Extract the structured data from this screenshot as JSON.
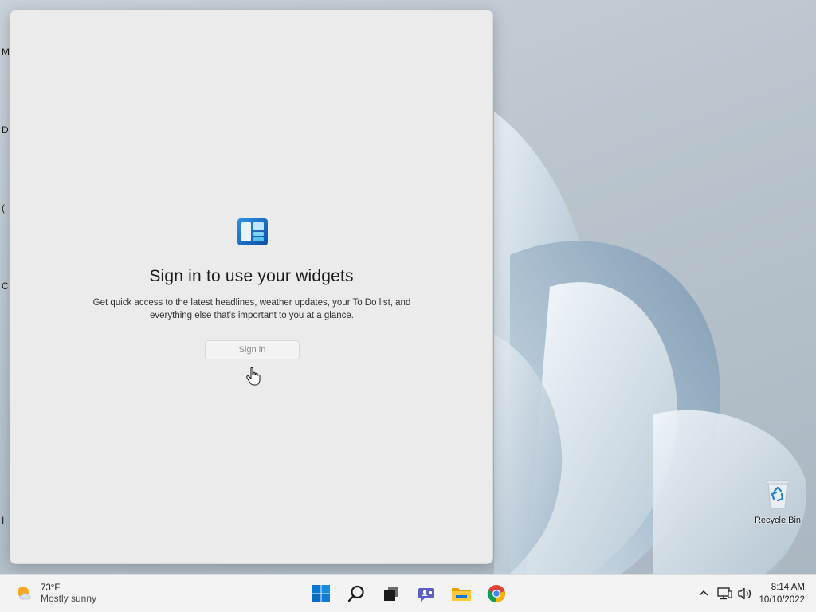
{
  "desktop": {
    "edge_labels": [
      "M",
      "D",
      "(",
      "C",
      "I"
    ],
    "recycle_bin": {
      "label": "Recycle Bin",
      "icon": "recycle-bin-icon"
    }
  },
  "widgets": {
    "logo_icon": "widgets-icon",
    "title": "Sign in to use your widgets",
    "description": "Get quick access to the latest headlines, weather updates, your To Do list, and everything else that's important to you at a glance.",
    "sign_in_label": "Sign in"
  },
  "taskbar": {
    "weather": {
      "icon": "partly-sunny-icon",
      "temperature": "73°F",
      "condition": "Mostly sunny"
    },
    "apps": [
      {
        "name": "start",
        "icon": "windows-logo-icon"
      },
      {
        "name": "search",
        "icon": "search-icon"
      },
      {
        "name": "task-view",
        "icon": "task-view-icon"
      },
      {
        "name": "chat",
        "icon": "chat-icon"
      },
      {
        "name": "file-explorer",
        "icon": "folder-icon"
      },
      {
        "name": "chrome",
        "icon": "chrome-icon"
      }
    ],
    "tray": {
      "icons": [
        "chevron-up-icon",
        "network-icon",
        "volume-icon"
      ]
    },
    "clock": {
      "time": "8:14 AM",
      "date": "10/10/2022"
    }
  },
  "colors": {
    "accent": "#0067c0",
    "panel_bg": "#ebebeb",
    "taskbar_bg": "#f3f3f3"
  }
}
